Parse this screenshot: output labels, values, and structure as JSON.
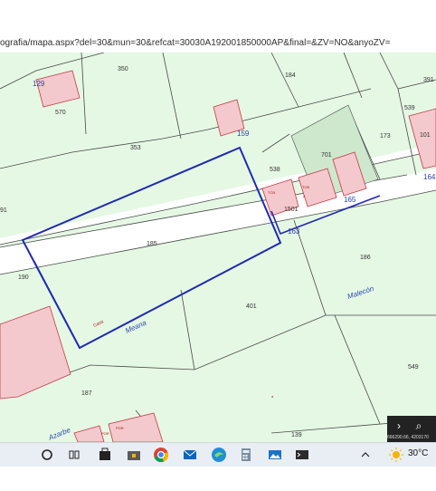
{
  "browser": {
    "url": "ografia/mapa.aspx?del=30&mun=30&refcat=30030A192001850000AP&final=&ZV=NO&anyoZV="
  },
  "map": {
    "parcels": [
      "350",
      "184",
      "570",
      "353",
      "538",
      "173",
      "391",
      "539",
      "101",
      "701",
      "91",
      "185",
      "186",
      "190",
      "401",
      "549",
      "187",
      "139",
      "1501"
    ],
    "house_numbers": [
      "129",
      "159",
      "165",
      "163",
      "164"
    ],
    "street_labels": [
      "Meana",
      "Malecón",
      "Azarbe",
      "Cami"
    ],
    "brick_labels": [
      "POR",
      "POR",
      "TCB",
      "TCB"
    ],
    "parcel_marks": [
      "a",
      "a"
    ]
  },
  "map_controls": {
    "next_icon": "chevron-right-icon",
    "search_icon": "magnifier-icon",
    "coordinates": "666290.66, 4203170"
  },
  "taskbar": {
    "search_icon": "circle-search-icon",
    "task_view_icon": "task-view-icon",
    "apps": [
      "store-bag-icon",
      "chrome-icon",
      "mail-icon",
      "edge-icon",
      "calculator-icon",
      "photos-icon",
      "terminal-icon"
    ],
    "weather_icon": "sun-icon",
    "temperature": "30°C",
    "system_icon": "chevron-up-icon"
  },
  "colors": {
    "map_background": "#e5f8e4",
    "parcel_outline": "#4a4a4a",
    "selected_parcel": "#1f2bb0",
    "building_fill": "#f4c9cd",
    "building_outline": "#c43b45",
    "courtyard_fill": "#cde8cd"
  }
}
